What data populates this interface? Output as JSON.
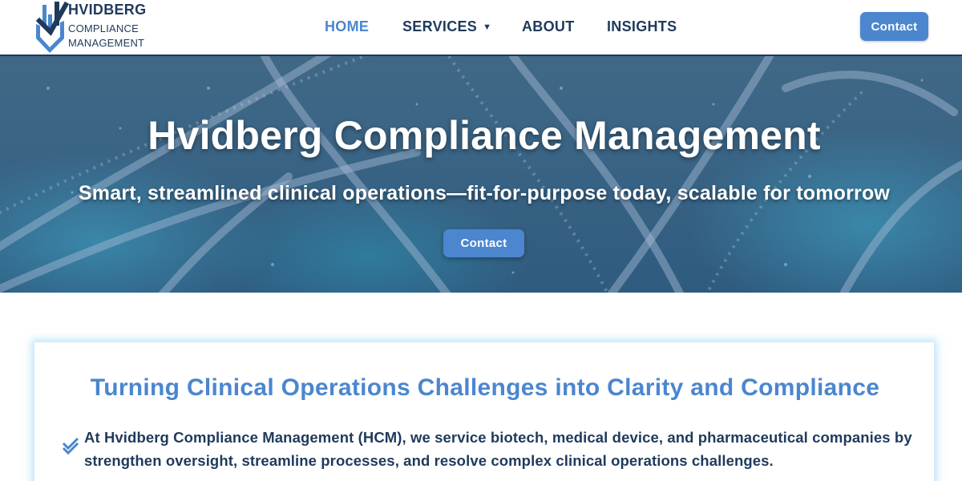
{
  "brand": {
    "name": "HVIDBERG",
    "line1": "COMPLIANCE",
    "line2": "MANAGEMENT",
    "logo_icon": "shield-check-logo-icon",
    "primary_color": "#1f3a5c",
    "accent_color": "#4b86cf"
  },
  "nav": {
    "items": [
      {
        "label": "HOME",
        "active": true
      },
      {
        "label": "SERVICES",
        "has_dropdown": true
      },
      {
        "label": "ABOUT"
      },
      {
        "label": "INSIGHTS"
      }
    ],
    "dropdown_icon": "chevron-down-icon",
    "contact_label": "Contact"
  },
  "hero": {
    "title": "Hvidberg Compliance Management",
    "subtitle": "Smart, streamlined clinical operations—fit-for-purpose today, scalable for tomorrow",
    "contact_label": "Contact",
    "background": "dna-strand-abstract-image"
  },
  "intro": {
    "heading": "Turning Clinical Operations Challenges into Clarity and Compliance",
    "bullet_icon": "double-check-icon",
    "text": "At Hvidberg Compliance Management (HCM), we service biotech, medical device, and pharmaceutical companies by strengthen oversight, streamline processes, and resolve complex clinical operations challenges."
  }
}
